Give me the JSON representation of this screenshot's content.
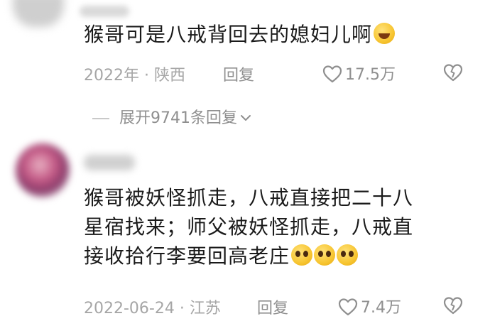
{
  "comment1": {
    "text": "猴哥可是八戒背回去的媳妇儿啊",
    "emoji": "laughing-emoji",
    "meta": "2022年 · 陕西",
    "reply_label": "回复",
    "likes": "17.5万"
  },
  "replies_toggle": {
    "label": "展开9741条回复"
  },
  "comment2": {
    "lines": [
      "猴哥被妖怪抓走，八戒直接把二十八",
      "星宿找来；师父被妖怪抓走，八戒直",
      "接收拾行李要回高老庄"
    ],
    "emoji": "pleading-face-emoji",
    "emoji_count": 3,
    "meta": "2022-06-24 · 江苏",
    "reply_label": "回复",
    "likes": "7.4万"
  },
  "icons": {
    "like": "heart-outline-icon",
    "dislike": "broken-heart-icon",
    "expand": "chevron-down-icon"
  },
  "colors": {
    "text": "#1a1a1a",
    "meta": "#a6a6a6",
    "action": "#8f8f8f"
  }
}
